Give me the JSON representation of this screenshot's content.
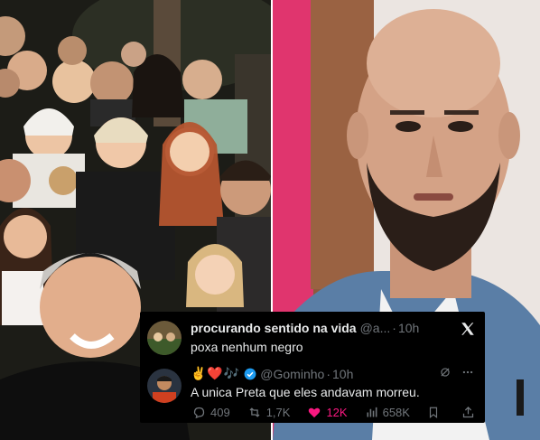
{
  "tweet_main": {
    "display_name": "procurando sentido na vida",
    "handle": "@a...",
    "time": "10h",
    "text": "poxa nenhum negro"
  },
  "tweet_reply": {
    "emoji_name": "✌️❤️🎶",
    "handle": "@Gominho",
    "time": "10h",
    "text": "A unica Preta que eles andavam morreu."
  },
  "actions": {
    "replies": "409",
    "reposts": "1,7K",
    "likes": "12K",
    "views": "658K"
  },
  "colors": {
    "like_accent": "#f91880",
    "verified": "#1d9bf0",
    "card_bg": "#000000"
  },
  "icons": [
    "x-logo-icon",
    "verified-badge-icon",
    "reply-icon",
    "repost-icon",
    "like-icon",
    "views-icon",
    "bookmark-icon",
    "share-icon",
    "mute-icon",
    "more-icon"
  ]
}
